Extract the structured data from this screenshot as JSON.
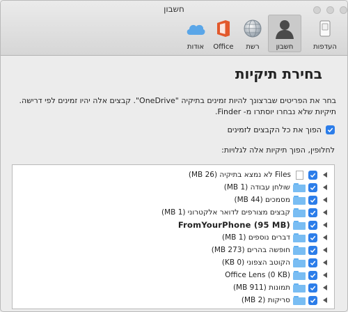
{
  "window": {
    "title": "חשבון"
  },
  "toolbar": {
    "items": [
      {
        "key": "preferences",
        "label": "העדפות"
      },
      {
        "key": "account",
        "label": "חשבון"
      },
      {
        "key": "network",
        "label": "רשת"
      },
      {
        "key": "office",
        "label": "Office"
      },
      {
        "key": "about",
        "label": "אודות"
      }
    ],
    "selected": "account"
  },
  "main": {
    "heading": "בחירת תיקיות",
    "description": "בחר את הפריטים שברצונך להיות זמינים בתיקיה \"OneDrive\". קבצים אלה יהיו זמינים לפי דרישה. תיקיות שלא נבחרו יוסתרו מ- Finder.",
    "toggle_all_label": "הפוך את כל הקבצים לזמינים",
    "toggle_all_checked": true,
    "instructions": "לחלופין, הפוך תיקיות אלה לגלויות:"
  },
  "folders": [
    {
      "name": "Files לא נמצא בתיקיה (26 MB)",
      "type": "file",
      "checked": true,
      "expandable": true
    },
    {
      "name": "שולחן עבודה (1 MB)",
      "type": "folder",
      "checked": true,
      "expandable": true
    },
    {
      "name": "מסמכים (44 MB)",
      "type": "folder",
      "checked": true,
      "expandable": true
    },
    {
      "name": "קבצים מצורפים לדואר אלקטרוני (1 MB)",
      "type": "folder",
      "checked": true,
      "expandable": true
    },
    {
      "name": "FromYourPhone (95 MB)",
      "type": "folder",
      "checked": true,
      "expandable": true
    },
    {
      "name": "דברים נוספים (1 MB)",
      "type": "folder",
      "checked": true,
      "expandable": true
    },
    {
      "name": "חופשה בהרים (273 MB)",
      "type": "folder",
      "checked": true,
      "expandable": true
    },
    {
      "name": "הקוטב הצפוני (0 KB)",
      "type": "folder",
      "checked": true,
      "expandable": true
    },
    {
      "name": "Office Lens (0 KB)",
      "type": "folder",
      "checked": true,
      "expandable": true
    },
    {
      "name": "תמונות (911 MB)",
      "type": "folder",
      "checked": true,
      "expandable": true
    },
    {
      "name": "סריקות (2 MB)",
      "type": "folder",
      "checked": true,
      "expandable": true
    }
  ],
  "colors": {
    "accent": "#2c7de9",
    "folder": "#79bdf3",
    "office": "#e2592c",
    "cloud": "#5aa6e8"
  }
}
